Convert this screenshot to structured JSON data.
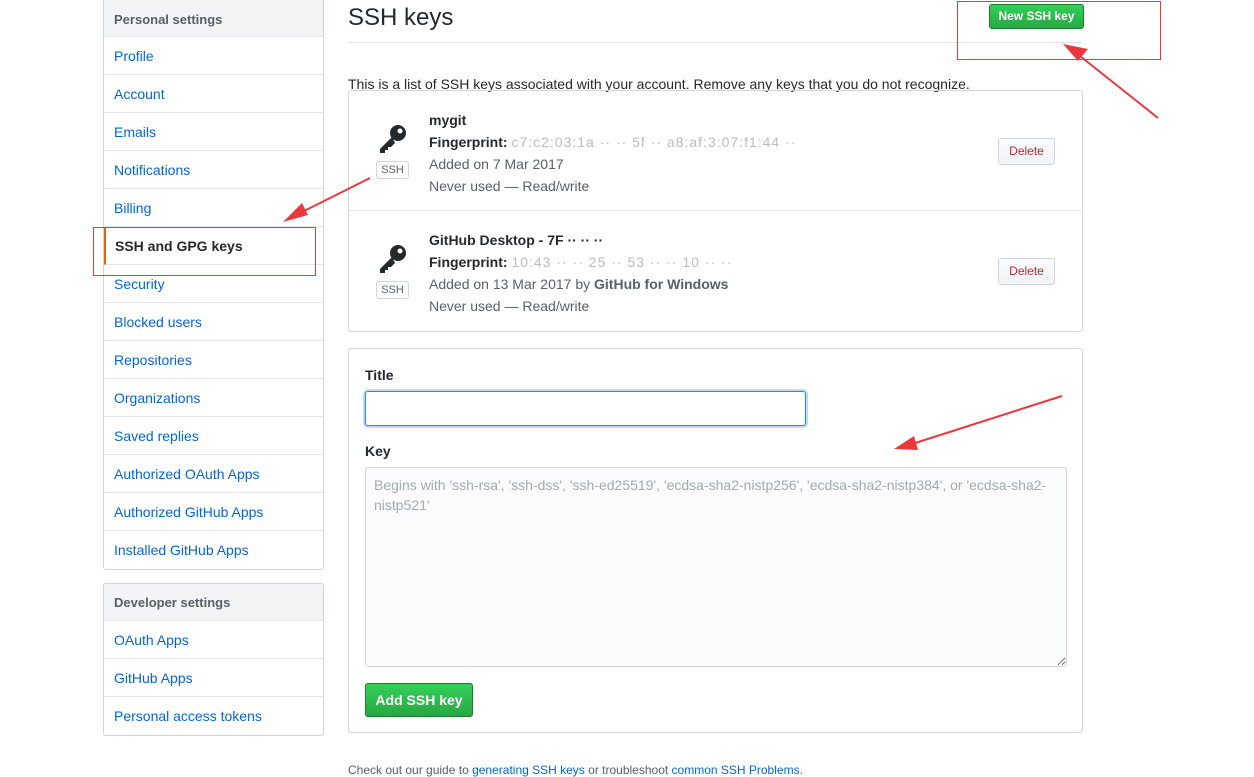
{
  "sidebar": {
    "personal_heading": "Personal settings",
    "items": [
      {
        "label": "Profile"
      },
      {
        "label": "Account"
      },
      {
        "label": "Emails"
      },
      {
        "label": "Notifications"
      },
      {
        "label": "Billing"
      },
      {
        "label": "SSH and GPG keys",
        "selected": true
      },
      {
        "label": "Security"
      },
      {
        "label": "Blocked users"
      },
      {
        "label": "Repositories"
      },
      {
        "label": "Organizations"
      },
      {
        "label": "Saved replies"
      },
      {
        "label": "Authorized OAuth Apps"
      },
      {
        "label": "Authorized GitHub Apps"
      },
      {
        "label": "Installed GitHub Apps"
      }
    ],
    "developer_heading": "Developer settings",
    "dev_items": [
      {
        "label": "OAuth Apps"
      },
      {
        "label": "GitHub Apps"
      },
      {
        "label": "Personal access tokens"
      }
    ]
  },
  "header": {
    "title": "SSH keys",
    "new_button": "New SSH key"
  },
  "description": "This is a list of SSH keys associated with your account. Remove any keys that you do not recognize.",
  "keys": [
    {
      "title": "mygit",
      "fingerprint_label": "Fingerprint:",
      "fingerprint_value": "c7:c2:03:1a ·· ·· 5f ·· a8:af:3:07:f1:44 ··",
      "added": "Added on 7 Mar 2017",
      "added_by": "",
      "usage": "Never used — Read/write",
      "type_label": "SSH",
      "delete_label": "Delete"
    },
    {
      "title": "GitHub Desktop - 7F ·· ·· ··",
      "fingerprint_label": "Fingerprint:",
      "fingerprint_value": "10:43 ·· ·· 25 ·· 53 ·· ·· 10 ·· ··",
      "added": "Added on 13 Mar 2017 by ",
      "added_by": "GitHub for Windows",
      "usage": "Never used — Read/write",
      "type_label": "SSH",
      "delete_label": "Delete"
    }
  ],
  "form": {
    "title_label": "Title",
    "title_value": "",
    "key_label": "Key",
    "key_placeholder": "Begins with 'ssh-rsa', 'ssh-dss', 'ssh-ed25519', 'ecdsa-sha2-nistp256', 'ecdsa-sha2-nistp384', or 'ecdsa-sha2-nistp521'",
    "submit_label": "Add SSH key"
  },
  "footer": {
    "prefix": "Check out our guide to ",
    "link1": "generating SSH keys",
    "middle": " or troubleshoot ",
    "link2": "common SSH Problems",
    "suffix": "."
  },
  "colors": {
    "link": "#0366d6",
    "primary_green": "#28a745",
    "danger": "#cb2431",
    "annotation_red": "#e8393f",
    "selected_border": "#e36209"
  }
}
